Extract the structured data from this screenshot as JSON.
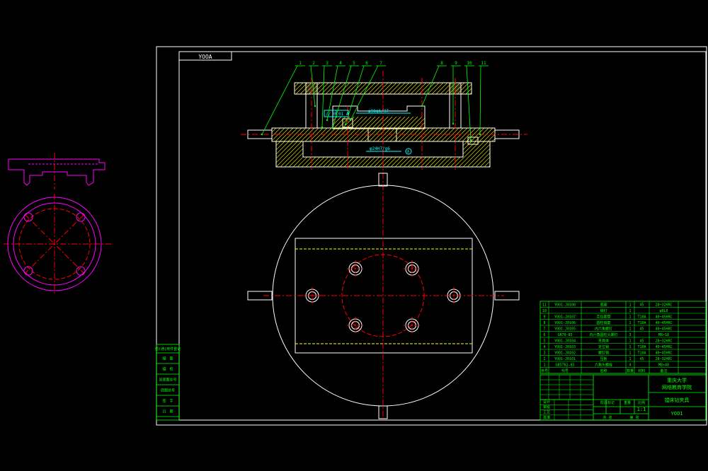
{
  "title_tag": "YOOA",
  "balloons": [
    "1",
    "2",
    "3",
    "4",
    "5",
    "6",
    "7",
    "8",
    "9",
    "10",
    "11"
  ],
  "annotations": {
    "tolerance": "// 0.01 A",
    "dim_top": "φ90g6/H7",
    "dim_bottom": "φ24H7/g6",
    "datum": "A"
  },
  "left_stamps": [
    "借(通)用件登记",
    "描　图",
    "描　校",
    "旧底图总号",
    "底图总号",
    "签　字",
    "日　期"
  ],
  "bom": [
    {
      "no": "11",
      "code": "YOO1-J0108",
      "name": "底座",
      "qty": "1",
      "mat": "45",
      "note": "28~32HRC"
    },
    {
      "no": "10",
      "code": "",
      "name": "销钉",
      "qty": "1",
      "mat": "",
      "note": "φ8L0"
    },
    {
      "no": "9",
      "code": "YOO1-J0107",
      "name": "定位套筒",
      "qty": "1",
      "mat": "T10A",
      "note": "40~45HRC"
    },
    {
      "no": "8",
      "code": "YOO1-J0106",
      "name": "圆柱销套",
      "qty": "1",
      "mat": "T10A",
      "note": "40~45HRC"
    },
    {
      "no": "7",
      "code": "YOO1-J0105",
      "name": "内六角螺钉",
      "qty": "1",
      "mat": "45",
      "note": "40~45HRC"
    },
    {
      "no": "6",
      "code": "GB70-85",
      "name": "内六角圆柱头螺钉",
      "qty": "3",
      "mat": "",
      "note": "M8×18"
    },
    {
      "no": "5",
      "code": "YOO1-J0104",
      "name": "夹具体",
      "qty": "1",
      "mat": "45",
      "note": "28~32HRC"
    },
    {
      "no": "4",
      "code": "YOO1-J0103",
      "name": "定位销",
      "qty": "1",
      "mat": "T10A",
      "note": "40~45HRC"
    },
    {
      "no": "3",
      "code": "YOO1-J0102",
      "name": "螺钉销",
      "qty": "1",
      "mat": "T10A",
      "note": "40~45HRC"
    },
    {
      "no": "2",
      "code": "YOO1-J0101",
      "name": "压板",
      "qty": "1",
      "mat": "45",
      "note": "28~32HRC"
    },
    {
      "no": "1",
      "code": "GB5782-85",
      "name": "六角头螺栓",
      "qty": "4",
      "mat": "",
      "note": "M8×40"
    }
  ],
  "bom_header": [
    "序号",
    "代号",
    "名称",
    "数量",
    "材料",
    "备注"
  ],
  "title_block": {
    "school": "重庆大学",
    "dept": "网络教育学院",
    "drawing_name": "镗床钻夹具",
    "scale": "1:1",
    "drawing_no": "YOO1",
    "rows": [
      "设计",
      "审核",
      "工艺",
      "批准"
    ],
    "phase": "阶段标记",
    "weight": "重量",
    "ratio": "比例",
    "sheet_a": "共 张",
    "sheet_b": "第 张"
  },
  "colors": {
    "frame": "#ffffff",
    "balloon": "#00ff00",
    "centerline": "#ff0000",
    "section": "#ffff00",
    "dimension": "#00ffff",
    "profile": "#ff00ff",
    "table": "#00ff00"
  }
}
